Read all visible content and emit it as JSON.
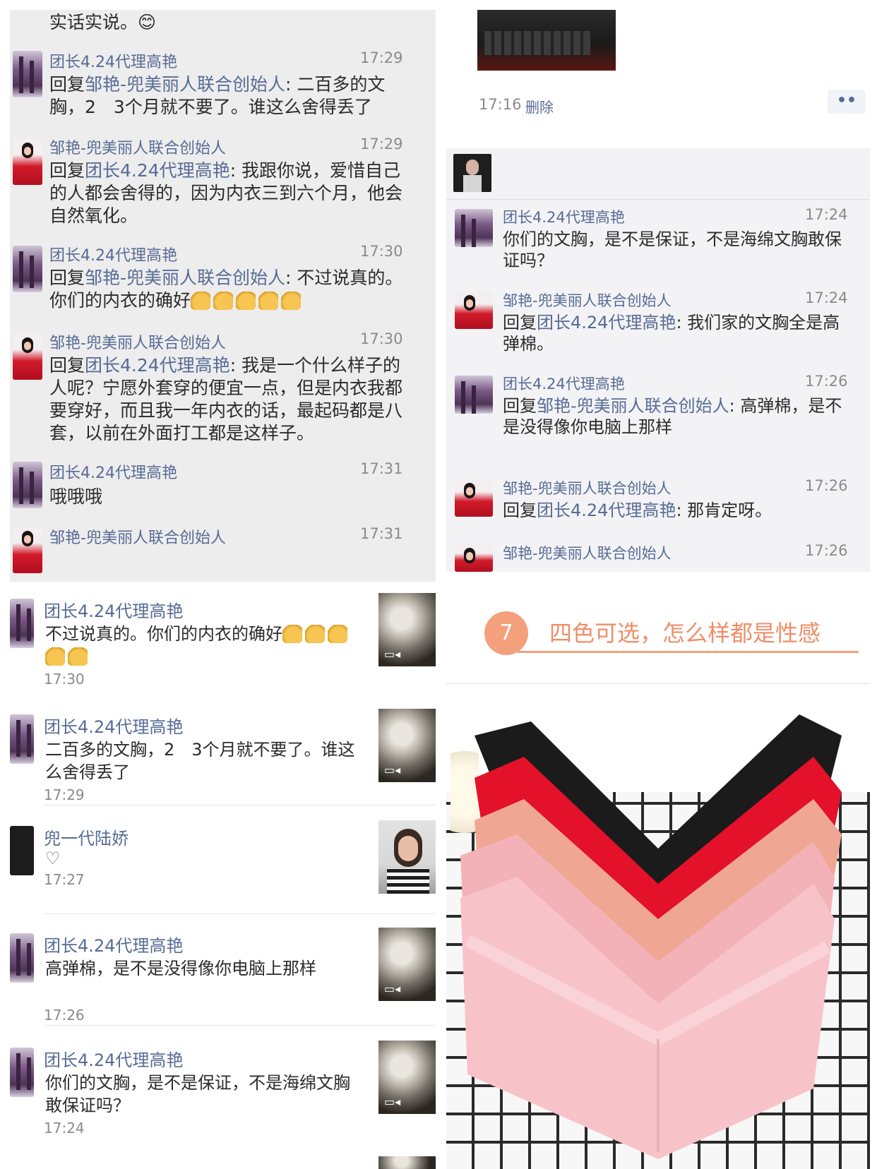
{
  "top_left": {
    "top_fragment": "实话实说。😊",
    "messages": [
      {
        "sender": "团长4.24代理高艳",
        "time": "17:29",
        "prefix": "回复",
        "quoted": "邹艳-兜美丽人联合创始人",
        "body": ": 二百多的文胸，2　3个月就不要了。谁这么舍得丢了"
      },
      {
        "sender": "邹艳-兜美丽人联合创始人",
        "time": "17:29",
        "prefix": "回复",
        "quoted": "团长4.24代理高艳",
        "body": ": 我跟你说，爱惜自己的人都会舍得的，因为内衣三到六个月，他会自然氧化。"
      },
      {
        "sender": "团长4.24代理高艳",
        "time": "17:30",
        "prefix": "回复",
        "quoted": "邹艳-兜美丽人联合创始人",
        "body": ": 不过说真的。你们的内衣的确好"
      },
      {
        "sender": "邹艳-兜美丽人联合创始人",
        "time": "17:30",
        "prefix": "回复",
        "quoted": "团长4.24代理高艳",
        "body": ": 我是一个什么样子的人呢？宁愿外套穿的便宜一点，但是内衣我都要穿好，而且我一年内衣的话，最起码都是八套，以前在外面打工都是这样子。"
      },
      {
        "sender": "团长4.24代理高艳",
        "time": "17:31",
        "prefix": "",
        "quoted": "",
        "body": "哦哦哦"
      },
      {
        "sender": "邹艳-兜美丽人联合创始人",
        "time": "17:31",
        "prefix": "",
        "quoted": "",
        "body": ""
      }
    ]
  },
  "top_right": {
    "post_time": "17:16",
    "delete_label": "删除",
    "more_label": "••",
    "messages": [
      {
        "sender": "团长4.24代理高艳",
        "time": "17:24",
        "prefix": "",
        "quoted": "",
        "body": "你们的文胸，是不是保证，不是海绵文胸敢保证吗？"
      },
      {
        "sender": "邹艳-兜美丽人联合创始人",
        "time": "17:24",
        "prefix": "回复",
        "quoted": "团长4.24代理高艳",
        "body": ": 我们家的文胸全是高弹棉。"
      },
      {
        "sender": "团长4.24代理高艳",
        "time": "17:26",
        "prefix": "回复",
        "quoted": "邹艳-兜美丽人联合创始人",
        "body": ": 高弹棉，是不是没得像你电脑上那样"
      },
      {
        "sender": "邹艳-兜美丽人联合创始人",
        "time": "17:26",
        "prefix": "回复",
        "quoted": "团长4.24代理高艳",
        "body": ": 那肯定呀。"
      },
      {
        "sender": "邹艳-兜美丽人联合创始人",
        "time": "17:26",
        "prefix": "",
        "quoted": "",
        "body": ""
      }
    ]
  },
  "bottom_left": {
    "comments": [
      {
        "sender": "团长4.24代理高艳",
        "body": "不过说真的。你们的内衣的确好",
        "time": "17:30"
      },
      {
        "sender": "团长4.24代理高艳",
        "body": "二百多的文胸，2　3个月就不要了。谁这么舍得丢了",
        "time": "17:29"
      },
      {
        "sender": "兜一代陆娇",
        "body": "",
        "time": "17:27"
      },
      {
        "sender": "团长4.24代理高艳",
        "body": "高弹棉，是不是没得像你电脑上那样",
        "time": "17:26"
      },
      {
        "sender": "团长4.24代理高艳",
        "body": "你们的文胸，是不是保证，不是海绵文胸敢保证吗？",
        "time": "17:24"
      }
    ]
  },
  "bottom_right": {
    "badge_number": "7",
    "headline": "四色可选，怎么样都是性感"
  },
  "colors": {
    "link": "#576b95",
    "badge": "#f4a07c",
    "headline": "#ef8e68"
  }
}
